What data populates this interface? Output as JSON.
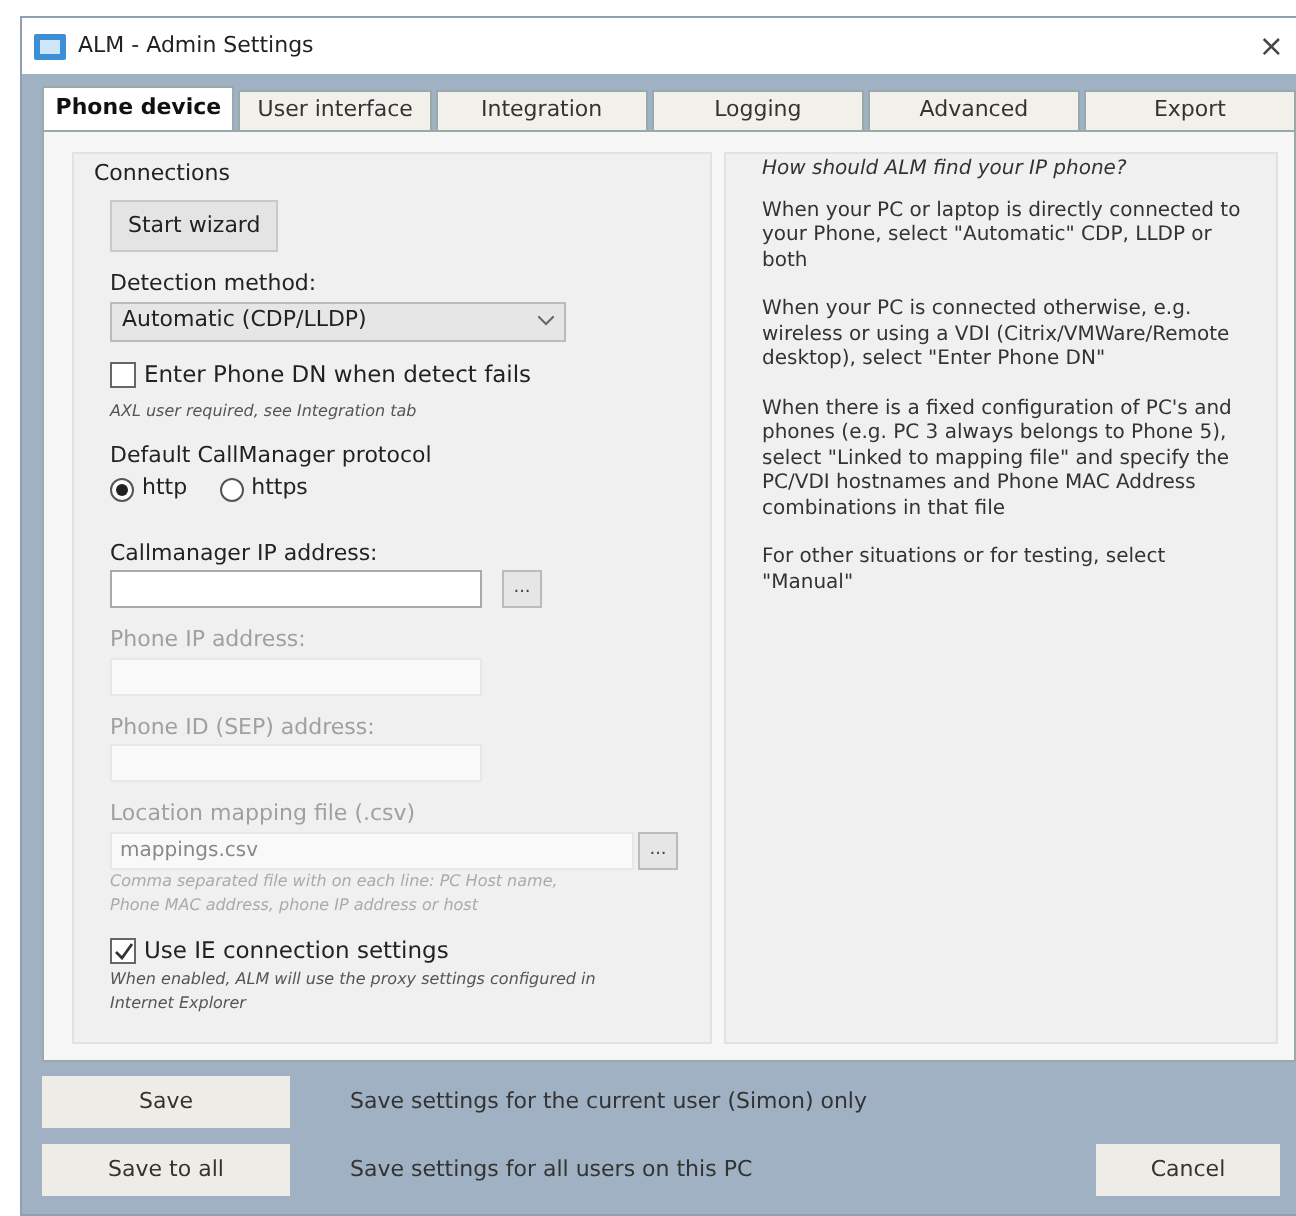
{
  "window": {
    "title": "ALM - Admin Settings",
    "close": "×"
  },
  "tabs": [
    {
      "label": "Phone device",
      "selected": true
    },
    {
      "label": "User interface",
      "selected": false
    },
    {
      "label": "Integration",
      "selected": false
    },
    {
      "label": "Logging",
      "selected": false
    },
    {
      "label": "Advanced",
      "selected": false
    },
    {
      "label": "Export",
      "selected": false
    }
  ],
  "connections": {
    "title": "Connections",
    "wizard_button": "Start wizard",
    "detection": {
      "label": "Detection method:",
      "value": "Automatic (CDP/LLDP)"
    },
    "enter_dn": {
      "label": "Enter Phone DN when detect fails",
      "checked": false
    },
    "enter_dn_note": "AXL user required, see Integration tab",
    "protocol": {
      "label": "Default CallManager protocol",
      "options": [
        {
          "label": "http",
          "selected": true
        },
        {
          "label": "https",
          "selected": false
        }
      ]
    },
    "fields": [
      {
        "label": "Callmanager IP address:",
        "disabled": false,
        "browse": "..."
      },
      {
        "label": "Phone IP address:",
        "disabled": true
      },
      {
        "label": "Phone ID (SEP) address:",
        "disabled": true
      },
      {
        "label": "Location mapping file (.csv)",
        "value": "mappings.csv",
        "disabled": true,
        "browse": "...",
        "note": "Comma separated file with on each line: PC Host name, Phone MAC address, phone IP address or host"
      }
    ],
    "use_ie": {
      "label": "Use IE connection settings",
      "checked": true
    },
    "use_ie_note": "When enabled, ALM will use the proxy settings configured in Internet Explorer"
  },
  "help": {
    "heading": "How should ALM find your IP phone?",
    "paragraphs": [
      "When your PC or laptop is directly connected to your Phone, select \"Automatic\" CDP, LLDP or both",
      "When your PC is connected otherwise, e.g. wireless or using a VDI (Citrix/VMWare/Remote desktop), select \"Enter Phone DN\"",
      "When there is a fixed configuration of PC's and phones (e.g. PC 3 always belongs to Phone 5), select \"Linked to mapping file\" and specify the PC/VDI hostnames and Phone MAC Address combinations in that file",
      "For other situations or for testing, select \"Manual\""
    ]
  },
  "footer": {
    "actions": [
      {
        "button": "Save",
        "description": "Save settings for the current user (Simon) only"
      },
      {
        "button": "Save to all",
        "description": "Save settings for all users on this PC"
      }
    ],
    "cancel": "Cancel"
  }
}
